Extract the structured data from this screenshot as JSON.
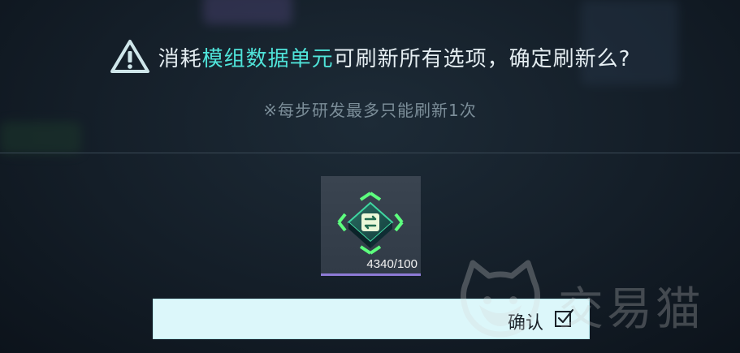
{
  "dialog": {
    "title_prefix": "消耗",
    "title_highlight": "模组数据单元",
    "title_suffix": "可刷新所有选项，确定刷新么?",
    "note": "※每步研发最多只能刷新1次"
  },
  "item": {
    "icon": "module-refresh-chip-icon",
    "count": "4340/100",
    "rarity_color": "#8e7bd6"
  },
  "confirm": {
    "label": "确认",
    "icon": "checkbox-check-icon"
  },
  "watermark": {
    "text": "交易猫",
    "icon": "cat-logo-icon"
  },
  "colors": {
    "highlight": "#4fe3d9",
    "button_bg": "#dcf7fa",
    "text_primary": "#e4edf1",
    "text_muted": "#7b8d98"
  }
}
